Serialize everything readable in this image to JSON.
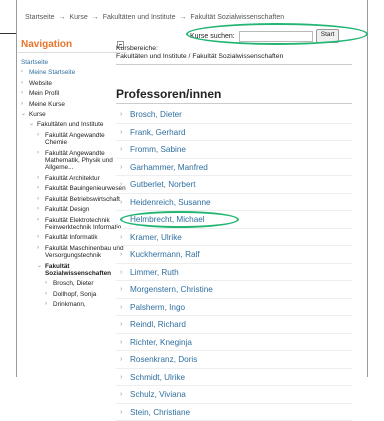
{
  "breadcrumb": [
    "Startseite",
    "Kurse",
    "Fakultäten und Institute",
    "Fakultät Sozialwissenschaften"
  ],
  "breadcrumb_separator": "→",
  "search": {
    "label": "Kurse suchen:",
    "button": "Start",
    "value": ""
  },
  "nav": {
    "title": "Navigation",
    "items": [
      "Startseite",
      "Meine Startseite",
      "Website",
      "Mein Profil",
      "Meine Kurse",
      "Kurse",
      "Fakultäten und Institute",
      "Fakultät Angewandte Chemie",
      "Fakultät Angewandte Mathematik, Physik und Allgeme...",
      "Fakultät Architektur",
      "Fakultät Bauingenieurwesen",
      "Fakultät Betriebswirtschaft",
      "Fakultät Design",
      "Fakultät Elektrotechnik Feinwerktechnik Informatio...",
      "Fakultät Informatik",
      "Fakultät Maschinenbau und Versorgungstechnik",
      "Fakultät Sozialwissenschaften",
      "Brosch, Dieter",
      "Dollhopf, Sonja",
      "Drinkmann,"
    ]
  },
  "kursbereiche": {
    "label": "Kursbereiche:",
    "path": "Fakultäten und Institute / Fakultät Sozialwissenschaften"
  },
  "professors": {
    "heading": "Professoren/innen",
    "items": [
      "Brosch, Dieter",
      "Frank, Gerhard",
      "Fromm, Sabine",
      "Garhammer, Manfred",
      "Gutberlet, Norbert",
      "Heidenreich, Susanne",
      "Helmbrecht, Michael",
      "Kramer, Ulrike",
      "Kuckhermann, Ralf",
      "Limmer, Ruth",
      "Morgenstern, Christine",
      "Palsherm, Ingo",
      "Reindl, Richard",
      "Richter, Kneginja",
      "Rosenkranz, Doris",
      "Schmidt, Ulrike",
      "Schulz, Viviana",
      "Stein, Christiane"
    ]
  },
  "colors": {
    "nav_title": "#e8752b",
    "link": "#2f6f9f",
    "highlight": "#22b573"
  }
}
